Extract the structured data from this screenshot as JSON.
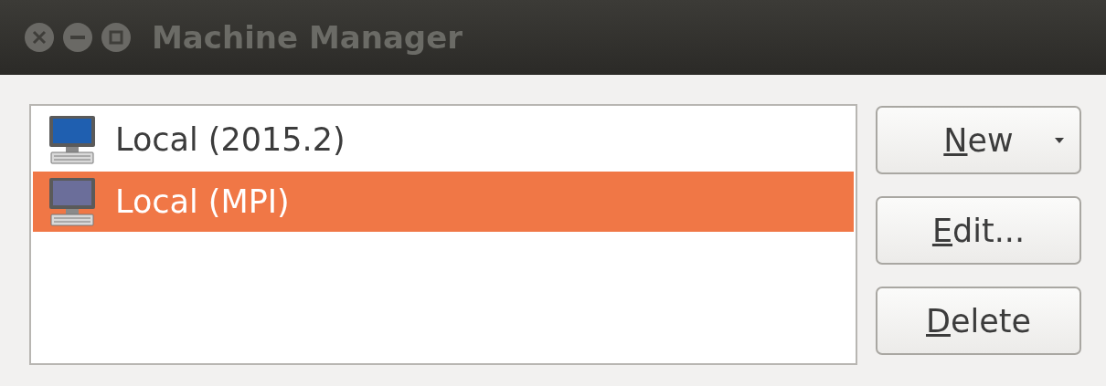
{
  "window": {
    "title": "Machine Manager"
  },
  "machines": [
    {
      "name": "Local (2015.2)",
      "selected": false
    },
    {
      "name": "Local (MPI)",
      "selected": true
    }
  ],
  "buttons": [
    {
      "label": "New",
      "mnemonic": true,
      "kind": "menu"
    },
    {
      "label": "Edit...",
      "mnemonic": true,
      "kind": "plain"
    },
    {
      "label": "Delete",
      "mnemonic": true,
      "kind": "plain"
    }
  ]
}
